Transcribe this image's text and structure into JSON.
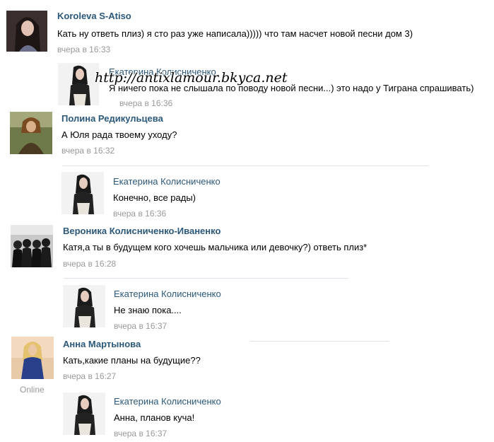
{
  "comments": [
    {
      "author": "Koroleva S-Atiso",
      "text": "Кать ну ответь плиз) я сто раз уже написала))))) что там насчет новой песни дом 3)",
      "time": "вчера в 16:33",
      "reply": {
        "author": "Екатерина Колисниченко",
        "text": "Я ничего пока не слышала по поводу новой песни...) это надо у Тиграна спрашивать)",
        "time": "вчера в 16:36"
      }
    },
    {
      "author": "Полина Редикульцева",
      "text": "А Юля рада твоему уходу?",
      "time": "вчера в 16:32",
      "reply": {
        "author": "Екатерина Колисниченко",
        "text": "Конечно, все рады)",
        "time": "вчера в 16:36"
      }
    },
    {
      "author": "Вероника Колисниченко-Иваненко",
      "text": "Катя,а ты в будущем кого хочешь мальчика или девочку?) ответь плиз*",
      "time": "вчера в 16:28",
      "reply": {
        "author": "Екатерина Колисниченко",
        "text": "Не знаю пока....",
        "time": "вчера в 16:37"
      }
    },
    {
      "author": "Анна Мартынова",
      "text": "Кать,какие планы на будущие??",
      "time": "вчера в 16:27",
      "status": "Online",
      "reply": {
        "author": "Екатерина Колисниченко",
        "text": "Анна, планов куча!",
        "time": "вчера в 16:37"
      }
    }
  ],
  "watermark": "http://antixlamour.bkyca.net"
}
